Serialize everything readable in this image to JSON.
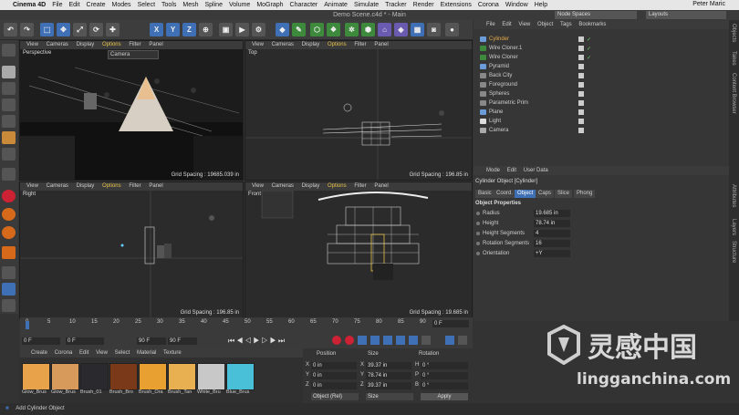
{
  "menubar": {
    "apple": "",
    "app": "Cinema 4D",
    "items": [
      "File",
      "Edit",
      "Create",
      "Modes",
      "Select",
      "Tools",
      "Mesh",
      "Spline",
      "Volume",
      "MoGraph",
      "Character",
      "Animate",
      "Simulate",
      "Tracker",
      "Render",
      "Extensions",
      "Corona",
      "Window",
      "Help"
    ],
    "user": "Peter Maric"
  },
  "window_title": "Demo Scene.c4d * - Main",
  "node_spaces": "Node Spaces",
  "layouts": "Layouts",
  "toolbar_icons": [
    "undo",
    "redo",
    "move",
    "scale",
    "rotate",
    "x-axis",
    "y-axis",
    "z-axis",
    "world",
    "render-view",
    "render",
    "render-settings",
    "cube",
    "cloner",
    "effector",
    "light",
    "camera"
  ],
  "viewports": [
    {
      "name": "Perspective",
      "menu": [
        "View",
        "Cameras",
        "Display",
        "Options",
        "Filter",
        "Panel"
      ],
      "camera": "Camera",
      "grid": "Grid Spacing : 19685.039 in"
    },
    {
      "name": "Top",
      "menu": [
        "View",
        "Cameras",
        "Display",
        "Options",
        "Filter",
        "Panel"
      ],
      "grid": "Grid Spacing : 196.85 in"
    },
    {
      "name": "Right",
      "menu": [
        "View",
        "Cameras",
        "Display",
        "Options",
        "Filter",
        "Panel"
      ],
      "grid": "Grid Spacing : 196.85 in"
    },
    {
      "name": "Front",
      "menu": [
        "View",
        "Cameras",
        "Display",
        "Options",
        "Filter",
        "Panel"
      ],
      "grid": "Grid Spacing : 19.685 in"
    }
  ],
  "object_manager": {
    "menu": [
      "File",
      "Edit",
      "View",
      "Object",
      "Tags",
      "Bookmarks"
    ],
    "objects": [
      {
        "name": "Cylinder",
        "selected": true
      },
      {
        "name": "Wire Cloner.1",
        "selected": false
      },
      {
        "name": "Wire Cloner",
        "selected": false
      },
      {
        "name": "Pyramid",
        "selected": false
      },
      {
        "name": "Back City",
        "selected": false
      },
      {
        "name": "Foreground",
        "selected": false
      },
      {
        "name": "Spheres",
        "selected": false
      },
      {
        "name": "Parametric Prim",
        "selected": false
      },
      {
        "name": "Plane",
        "selected": false
      },
      {
        "name": "Light",
        "selected": false
      },
      {
        "name": "Camera",
        "selected": false
      }
    ]
  },
  "attributes": {
    "menu": [
      "Mode",
      "Edit",
      "User Data"
    ],
    "object_title": "Cylinder Object [Cylinder]",
    "tabs": [
      "Basic",
      "Coord.",
      "Object",
      "Caps",
      "Slice",
      "Phong"
    ],
    "active_tab": "Object",
    "section": "Object Properties",
    "props": [
      {
        "label": "Radius",
        "value": "19.685 in"
      },
      {
        "label": "Height",
        "value": "78.74 in"
      },
      {
        "label": "Height Segments",
        "value": "4"
      },
      {
        "label": "Rotation Segments",
        "value": "16"
      },
      {
        "label": "Orientation",
        "value": "+Y"
      }
    ]
  },
  "side_tabs_right_top": [
    "Objects",
    "Takes",
    "Content Browser"
  ],
  "side_tabs_right_bottom": [
    "Attributes",
    "Layers",
    "Structure"
  ],
  "timeline": {
    "ticks": [
      "0",
      "5",
      "10",
      "15",
      "20",
      "25",
      "30",
      "35",
      "40",
      "45",
      "50",
      "55",
      "60",
      "65",
      "70",
      "75",
      "80",
      "85",
      "90"
    ],
    "frame_end_label": "0 F",
    "start": "0 F",
    "current": "0 F",
    "end": "90 F",
    "end2": "90 F"
  },
  "materials": {
    "menu": [
      "Create",
      "Corona",
      "Edit",
      "View",
      "Select",
      "Material",
      "Texture"
    ],
    "items": [
      {
        "name": "Glow_Brus",
        "color": "#e8a24a"
      },
      {
        "name": "Glow_Brus",
        "color": "#d89a5a"
      },
      {
        "name": "Brush_01",
        "color": "#2a2a2e"
      },
      {
        "name": "Brush_Bro",
        "color": "#7a3a1a"
      },
      {
        "name": "Brush_Ora",
        "color": "#e8a030"
      },
      {
        "name": "Brush_Tan",
        "color": "#e8b050"
      },
      {
        "name": "White_Bru",
        "color": "#c8c8c8"
      },
      {
        "name": "Blue_Brus",
        "color": "#4ac0d8"
      }
    ]
  },
  "coordinates": {
    "headers": [
      "Position",
      "Size",
      "Rotation"
    ],
    "rows": [
      {
        "axis": "X",
        "pos": "0 in",
        "size_axis": "X",
        "size": "39.37 in",
        "rot_axis": "H",
        "rot": "0 °"
      },
      {
        "axis": "Y",
        "pos": "0 in",
        "size_axis": "Y",
        "size": "78.74 in",
        "rot_axis": "P",
        "rot": "0 °"
      },
      {
        "axis": "Z",
        "pos": "0 in",
        "size_axis": "Z",
        "size": "39.37 in",
        "rot_axis": "B",
        "rot": "0 °"
      }
    ],
    "mode": "Object (Rel)",
    "size_mode": "Size",
    "apply": "Apply"
  },
  "status": "Add Cylinder Object",
  "watermark": {
    "cn": "灵感中国",
    "url": "lingganchina.com"
  },
  "colors": {
    "accent": "#3f6fb5",
    "highlight": "#e6a94a",
    "options": "#e6c24a"
  }
}
